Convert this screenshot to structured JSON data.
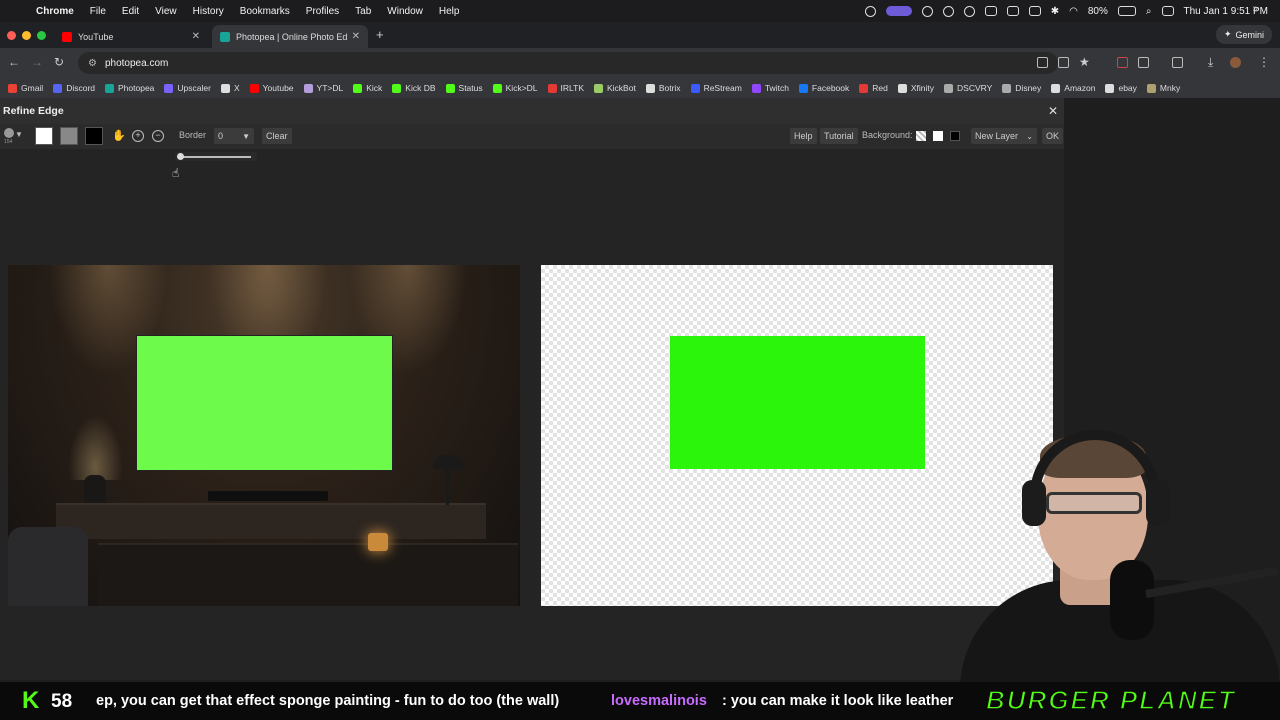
{
  "menubar": {
    "app": "Chrome",
    "items": [
      "File",
      "Edit",
      "View",
      "History",
      "Bookmarks",
      "Profiles",
      "Tab",
      "Window",
      "Help"
    ],
    "battery": "80%",
    "clock": "Thu Jan 1  9:51 PM"
  },
  "tabs": [
    {
      "title": "YouTube",
      "active": false
    },
    {
      "title": "Photopea | Online Photo Edit",
      "active": true
    }
  ],
  "gemini_label": "Gemini",
  "address": "photopea.com",
  "bookmarks": [
    {
      "label": "Gmail",
      "color": "#ea4335"
    },
    {
      "label": "Discord",
      "color": "#5865f2"
    },
    {
      "label": "Photopea",
      "color": "#18a497"
    },
    {
      "label": "Upscaler",
      "color": "#7b61ff"
    },
    {
      "label": "X",
      "color": "#dddddd"
    },
    {
      "label": "Youtube",
      "color": "#ff0000"
    },
    {
      "label": "YT>DL",
      "color": "#b39ddb"
    },
    {
      "label": "Kick",
      "color": "#53fc18"
    },
    {
      "label": "Kick DB",
      "color": "#53fc18"
    },
    {
      "label": "Status",
      "color": "#53fc18"
    },
    {
      "label": "Kick>DL",
      "color": "#53fc18"
    },
    {
      "label": "IRLTK",
      "color": "#e53935"
    },
    {
      "label": "KickBot",
      "color": "#9ccc65"
    },
    {
      "label": "Botrix",
      "color": "#dddddd"
    },
    {
      "label": "ReStream",
      "color": "#3d5afe"
    },
    {
      "label": "Twitch",
      "color": "#9146ff"
    },
    {
      "label": "Facebook",
      "color": "#1877f2"
    },
    {
      "label": "Red",
      "color": "#e53935"
    },
    {
      "label": "Xfinity",
      "color": "#dddddd"
    },
    {
      "label": "DSCVRY",
      "color": "#aaaaaa"
    },
    {
      "label": "Disney",
      "color": "#aaaaaa"
    },
    {
      "label": "Amazon",
      "color": "#dddddd"
    },
    {
      "label": "ebay",
      "color": "#dddddd"
    },
    {
      "label": "Mnky",
      "color": "#b0a070"
    }
  ],
  "photopea": {
    "dialog_title": "Refine Edge",
    "border_label": "Border",
    "border_value": "0",
    "clear_label": "Clear",
    "help_label": "Help",
    "tutorial_label": "Tutorial",
    "background_label": "Background:",
    "output_select": "New Layer",
    "ok_label": "OK",
    "brush_size": "154"
  },
  "stream": {
    "viewer_count": "58",
    "chat_message_tail": "ep, you can get that effect sponge painting - fun to do too (the wall)",
    "chat_user": "lovesmalinois",
    "chat_message": ": you can make it look like leather",
    "logo_text": "BURGER PLANET"
  },
  "colors": {
    "kick_green": "#53fc18",
    "tv_green": "#6dfa4a",
    "mask_green": "#2af50a",
    "chat_user": "#c86bff"
  }
}
